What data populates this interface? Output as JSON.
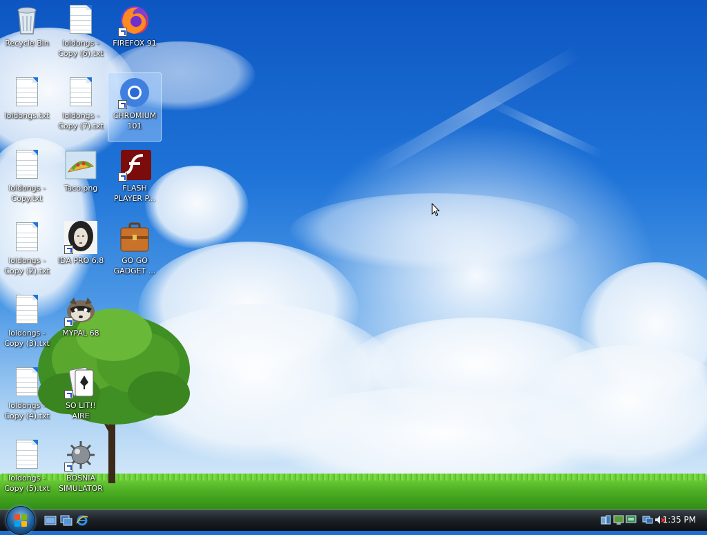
{
  "desktop": {
    "icons": [
      {
        "label": "Recycle Bin"
      },
      {
        "label": "loldongs - Copy (6).txt"
      },
      {
        "label": "FIREFOX 91"
      },
      {
        "label": "loldongs.txt"
      },
      {
        "label": "loldongs - Copy (7).txt"
      },
      {
        "label": "CHROMIUM 101"
      },
      {
        "label": "loldongs - Copy.txt"
      },
      {
        "label": "Taco.png"
      },
      {
        "label": "FLASH PLAYER P..."
      },
      {
        "label": "loldongs - Copy (2).txt"
      },
      {
        "label": "IDA PRO 6.8"
      },
      {
        "label": "GO GO GADGET ..."
      },
      {
        "label": "loldongs - Copy (3).txt"
      },
      {
        "label": "MYPAL 68"
      },
      {
        "label": "loldongs - Copy (4).txt"
      },
      {
        "label": "SO LIT!! AIRE"
      },
      {
        "label": "loldongs - Copy (5).txt"
      },
      {
        "label": "BOSNIA SIMULATOR"
      }
    ]
  },
  "taskbar": {
    "clock": "1:35 PM",
    "quick_launch": [
      "show-desktop-icon",
      "switch-windows-icon",
      "internet-explorer-icon"
    ],
    "tray_icons": [
      "network-icon",
      "network-icon",
      "network-icon",
      "display-icon",
      "volume-muted-icon"
    ]
  },
  "colors": {
    "sky": "#1d6fd0",
    "grass": "#4fb024",
    "taskbar": "#1d2227"
  }
}
